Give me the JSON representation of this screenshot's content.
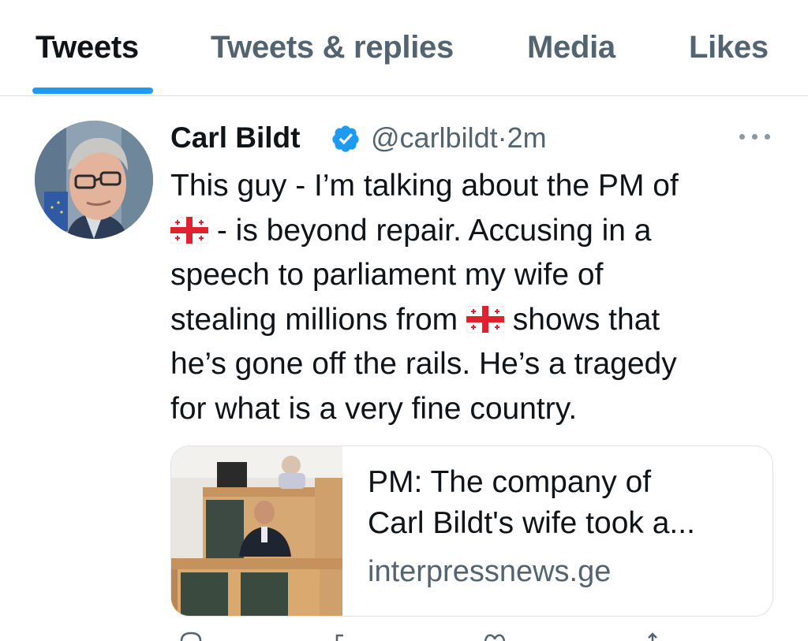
{
  "tabs": [
    {
      "label": "Tweets",
      "active": true
    },
    {
      "label": "Tweets & replies",
      "active": false
    },
    {
      "label": "Media",
      "active": false
    },
    {
      "label": "Likes",
      "active": false
    }
  ],
  "tweet": {
    "author_name": "Carl Bildt",
    "verified": true,
    "handle": "@carlbildt",
    "separator": "·",
    "time": "2m",
    "text_lines": [
      "This guy - I’m talking about the PM of",
      " - is beyond repair. Accusing in a",
      "speech to parliament my wife of",
      "stealing millions from",
      " shows that",
      "he’s gone off the rails. He’s a tragedy",
      "for what is a very fine country."
    ],
    "flag_icon": "georgia-flag-icon"
  },
  "link_card": {
    "title_lines": [
      "PM: The company of",
      "Carl Bildt's wife took a..."
    ],
    "domain": "interpressnews.ge"
  },
  "colors": {
    "accent": "#1d9bf0",
    "text_primary": "#0f1419",
    "text_secondary": "#536471",
    "divider": "#dfe3e7"
  }
}
